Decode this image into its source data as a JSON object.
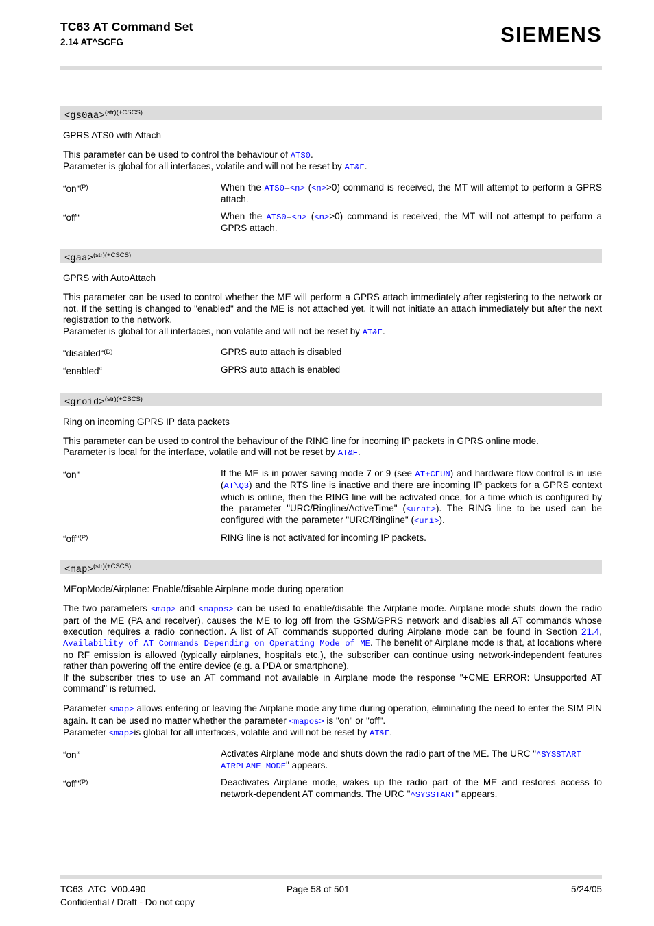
{
  "header": {
    "title": "TC63 AT Command Set",
    "subtitle": "2.14 AT^SCFG",
    "brand": "SIEMENS"
  },
  "sections": [
    {
      "id": "gs0aa",
      "param_name": "<gs0aa>",
      "param_sup": "(str)(+CSCS)",
      "subhead": "GPRS ATS0 with Attach",
      "paragraphs": [
        "This parameter can be used to control the behaviour of ATS0.",
        "Parameter is global for all interfaces, volatile and will not be reset by AT&F."
      ],
      "values": [
        {
          "label": "“on“",
          "sup": "(P)",
          "desc": "When the ATS0=<n> (<n>>0) command is received, the MT will attempt to perform a GPRS attach."
        },
        {
          "label": "“off“",
          "sup": "",
          "desc": "When the ATS0=<n> (<n>>0) command is received, the MT will not attempt to perform a GPRS attach."
        }
      ]
    },
    {
      "id": "gaa",
      "param_name": "<gaa>",
      "param_sup": "(str)(+CSCS)",
      "subhead": "GPRS with AutoAttach",
      "paragraphs": [
        "This parameter can be used to control whether the ME will perform a GPRS attach immediately after registering to the network or not. If the setting is changed to \"enabled\" and the ME is not attached yet, it will not initiate an attach immediately but after the next registration to the network.",
        "Parameter is global for all interfaces, non volatile and will not be reset by AT&F."
      ],
      "values": [
        {
          "label": "“disabled“",
          "sup": "(D)",
          "desc": "GPRS auto attach is disabled"
        },
        {
          "label": "“enabled“",
          "sup": "",
          "desc": "GPRS auto attach is enabled"
        }
      ]
    },
    {
      "id": "groid",
      "param_name": "<groid>",
      "param_sup": "(str)(+CSCS)",
      "subhead": "Ring on incoming GPRS IP data packets",
      "paragraphs": [
        "This parameter can be used to control the behaviour of the RING line for incoming IP packets in GPRS online mode.",
        "Parameter is local for the interface, volatile and will not be reset by AT&F."
      ],
      "values": [
        {
          "label": "“on“",
          "sup": "",
          "desc": "If the ME is in power saving mode 7 or 9 (see AT+CFUN) and hardware flow control is in use (AT\\Q3) and the RTS line is inactive and there are incoming IP packets for a GPRS context which is online, then the RING line will be activated once, for a time which is configured by the parameter \"URC/Ringline/ActiveTime\" (<urat>). The RING line to be used can be configured with the parameter \"URC/Ringline\" (<uri>)."
        },
        {
          "label": "“off“",
          "sup": "(P)",
          "desc": "RING line is not activated for incoming IP packets."
        }
      ]
    },
    {
      "id": "map",
      "param_name": "<map>",
      "param_sup": "(str)(+CSCS)",
      "subhead": "MEopMode/Airplane: Enable/disable Airplane mode during operation",
      "paragraphs": [
        "The two parameters <map> and <mapos> can be used to enable/disable the Airplane mode. Airplane mode shuts down the radio part of the ME (PA and receiver), causes the ME to log off from the GSM/GPRS network and disables all AT commands whose execution requires a radio connection. A list of AT commands supported during Airplane mode can be found in Section 21.4, Availability of AT Commands Depending on Operating Mode of ME. The benefit of Airplane mode is that, at locations where no RF emission is allowed (typically airplanes, hospitals etc.), the subscriber can continue using network-independent features rather than powering off the entire device (e.g. a PDA or smartphone).",
        "If the subscriber tries to use an AT command not available in Airplane mode the response \"+CME ERROR: Unsupported AT command\" is returned.",
        "Parameter <map> allows entering or leaving the Airplane mode any time during operation, eliminating the need to enter the SIM PIN again. It can be used no matter whether the parameter <mapos> is \"on\" or \"off\".",
        "Parameter <map>is global for all interfaces, volatile and will not be reset by AT&F."
      ],
      "cross_reference": {
        "section_number": "21.4",
        "section_title": "Availability of AT Commands Depending on Operating Mode of ME"
      },
      "values": [
        {
          "label": "“on“",
          "sup": "",
          "desc": "Activates Airplane mode and shuts down the radio part of the ME. The URC \"^SYSSTART AIRPLANE MODE\" appears."
        },
        {
          "label": "“off“",
          "sup": "(P)",
          "desc": "Deactivates Airplane mode, wakes up the radio part of the ME and restores access to network-dependent AT commands. The URC \"^SYSSTART\" appears."
        }
      ]
    }
  ],
  "inline_code": {
    "ats0": "ATS0",
    "atf": "AT&F",
    "n": "<n>",
    "at_cfun": "AT+CFUN",
    "at_q3": "AT\\Q3",
    "urat": "<urat>",
    "uri": "<uri>",
    "map": "<map>",
    "mapos": "<mapos>",
    "sysstart_airplane": "^SYSSTART AIRPLANE MODE",
    "sysstart": "^SYSSTART",
    "section_21_4": "21.4",
    "section_title_21_4": "Availability of AT Commands Depending on Operating Mode of ME"
  },
  "footer": {
    "doc_id": "TC63_ATC_V00.490",
    "page": "Page 58 of 501",
    "date": "5/24/05",
    "confidentiality": "Confidential / Draft - Do not copy"
  },
  "colors": {
    "band": "#dcdcdc",
    "link": "#0000ff",
    "text": "#000000"
  }
}
